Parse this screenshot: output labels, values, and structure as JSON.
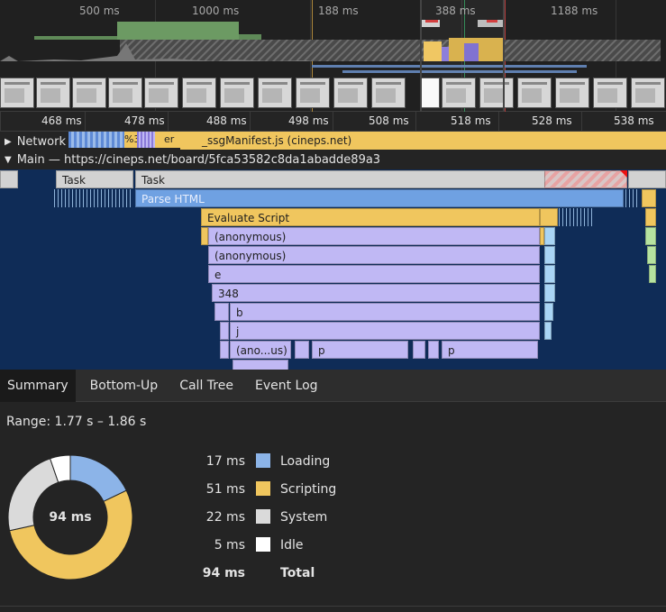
{
  "overview": {
    "labels": [
      "500 ms",
      "1000 ms",
      "188 ms",
      "388 ms",
      "1188 ms"
    ]
  },
  "ruler": {
    "ticks": [
      "468 ms",
      "478 ms",
      "488 ms",
      "498 ms",
      "508 ms",
      "518 ms",
      "528 ms",
      "538 ms"
    ]
  },
  "tracks": {
    "network_label": "Network",
    "network_prefix": "%3",
    "network_frag": "er",
    "network_bar": "_ssgManifest.js (cineps.net)",
    "main_label": "Main — https://cineps.net/board/5fca53582c8da1abadde89a3"
  },
  "flame": {
    "task1": "Task",
    "task2": "Task",
    "parse": "Parse HTML",
    "eval": "Evaluate Script",
    "anon1": "(anonymous)",
    "anon2": "(anonymous)",
    "e": "e",
    "n348": "348",
    "b": "b",
    "j": "j",
    "anous": "(ano...us)",
    "p1": "p",
    "p2": "p"
  },
  "tabs": [
    "Summary",
    "Bottom-Up",
    "Call Tree",
    "Event Log"
  ],
  "summary": {
    "range": "Range: 1.77 s – 1.86 s",
    "total_center": "94 ms",
    "rows": [
      {
        "value": "17 ms",
        "name": "Loading",
        "color": "#8cb4e8",
        "ms": 17
      },
      {
        "value": "51 ms",
        "name": "Scripting",
        "color": "#f0c65e",
        "ms": 51
      },
      {
        "value": "22 ms",
        "name": "System",
        "color": "#dadada",
        "ms": 22
      },
      {
        "value": "5 ms",
        "name": "Idle",
        "color": "#ffffff",
        "ms": 5
      }
    ],
    "total_value": "94 ms",
    "total_name": "Total"
  }
}
